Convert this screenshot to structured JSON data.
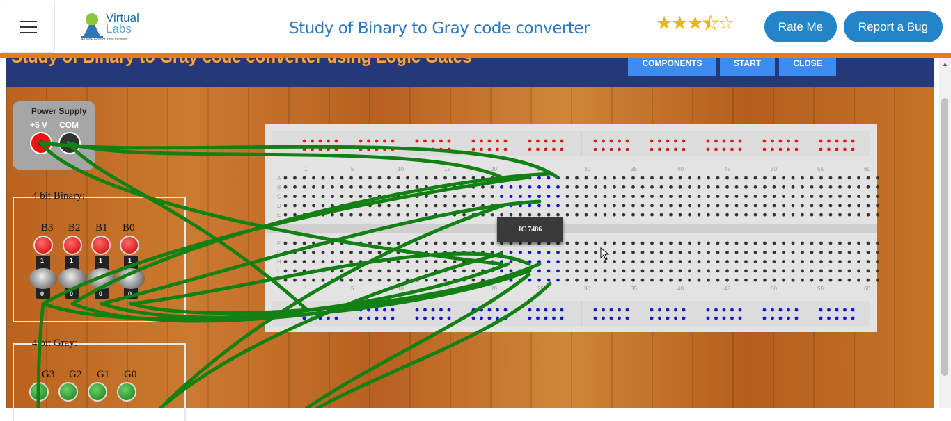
{
  "header": {
    "logo": {
      "brand_top": "Virtual",
      "brand_bottom": "Labs",
      "tagline": "An MoE Govt of India Initiative"
    },
    "title": "Study of Binary to Gray code converter",
    "rating": {
      "stars": 3.5,
      "max": 5
    },
    "rate_button": "Rate Me",
    "bug_button": "Report a Bug"
  },
  "simulator": {
    "title": "Study of Binary to Gray code converter using Logic Gates",
    "buttons": [
      "COMPONENTS",
      "START",
      "CLOSE"
    ],
    "power_supply": {
      "label": "Power Supply",
      "plus": "+5 V",
      "com": "COM"
    },
    "binary_panel": {
      "label": "4 bit Binary:",
      "inputs": [
        "B3",
        "B2",
        "B1",
        "B0"
      ],
      "switch_on": "1",
      "switch_off": "0"
    },
    "gray_panel": {
      "label": "4 bit Gray:",
      "outputs": [
        "G3",
        "G2",
        "G1",
        "G0"
      ]
    },
    "ic_label": "IC 7486",
    "column_numbers": [
      "1",
      "5",
      "10",
      "15",
      "20",
      "25",
      "30",
      "35",
      "40",
      "45",
      "50",
      "55",
      "60"
    ],
    "row_letters_top": [
      "A",
      "B",
      "C",
      "D",
      "E"
    ],
    "row_letters_bottom": [
      "F",
      "G",
      "H",
      "I",
      "J"
    ]
  },
  "colors": {
    "accent": "#2385c8",
    "orange": "#f07a10",
    "wire": "#138013",
    "header_bar": "#25397a"
  }
}
